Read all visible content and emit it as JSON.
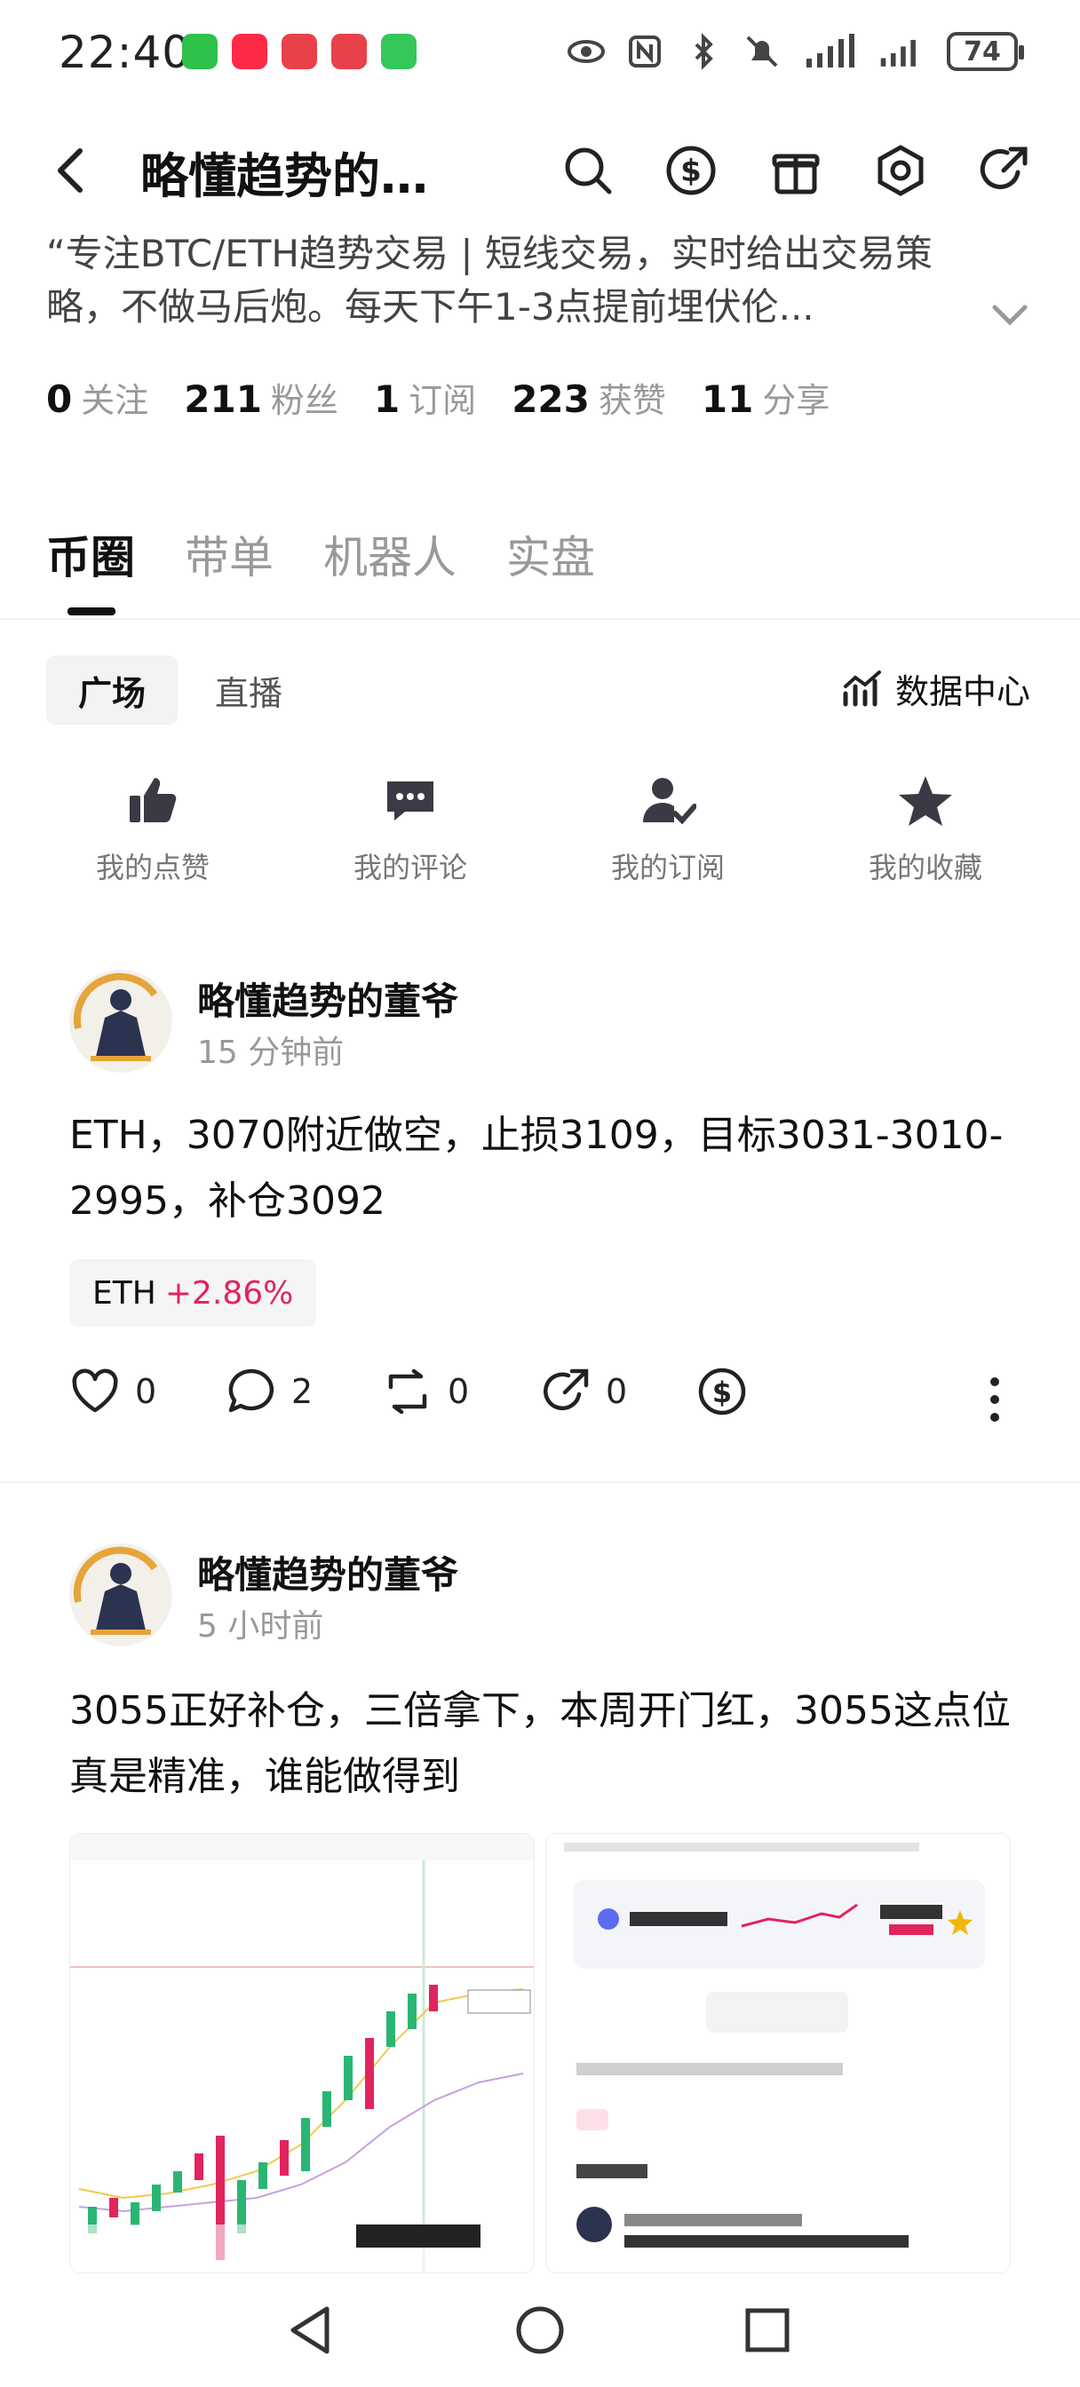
{
  "status_bar": {
    "time": "22:40",
    "battery": "74",
    "apps": [
      "wechat",
      "xiaohongshu",
      "app-red",
      "app-red-2",
      "wechat-green"
    ]
  },
  "header": {
    "title": "略懂趋势的…",
    "icons": [
      "search-icon",
      "dollar-icon",
      "gift-icon",
      "settings-icon",
      "share-icon"
    ]
  },
  "profile": {
    "bio": "“专注BTC/ETH趋势交易 | 短线交易，实时给出交易策略，不做马后炮。每天下午1-3点提前埋伏伦...",
    "stats": [
      {
        "num": "0",
        "label": "关注"
      },
      {
        "num": "211",
        "label": "粉丝"
      },
      {
        "num": "1",
        "label": "订阅"
      },
      {
        "num": "223",
        "label": "获赞"
      },
      {
        "num": "11",
        "label": "分享"
      }
    ]
  },
  "tabs": [
    {
      "label": "币圈",
      "active": true
    },
    {
      "label": "带单",
      "active": false
    },
    {
      "label": "机器人",
      "active": false
    },
    {
      "label": "实盘",
      "active": false
    }
  ],
  "sub_tabs": {
    "square": "广场",
    "live": "直播",
    "data_center": "数据中心"
  },
  "quick_actions": [
    {
      "label": "我的点赞",
      "icon": "thumbs-up-icon"
    },
    {
      "label": "我的评论",
      "icon": "comment-icon"
    },
    {
      "label": "我的订阅",
      "icon": "subscribe-icon"
    },
    {
      "label": "我的收藏",
      "icon": "star-icon"
    }
  ],
  "posts": [
    {
      "author": "略懂趋势的董爷",
      "time": "15 分钟前",
      "text": "ETH，3070附近做空，止损3109，目标3031-3010-2995，补仓3092",
      "tag": {
        "symbol": "ETH",
        "change": "+2.86%"
      },
      "likes": "0",
      "comments": "2",
      "reposts": "0",
      "shares": "0"
    },
    {
      "author": "略懂趋势的董爷",
      "time": "5 小时前",
      "text": "3055正好补仓，三倍拿下，本周开门红，3055这点位真是精准，谁能做得到"
    }
  ],
  "colors": {
    "accent_up": "#e0245e",
    "text_primary": "#111111",
    "text_secondary": "#999999"
  }
}
